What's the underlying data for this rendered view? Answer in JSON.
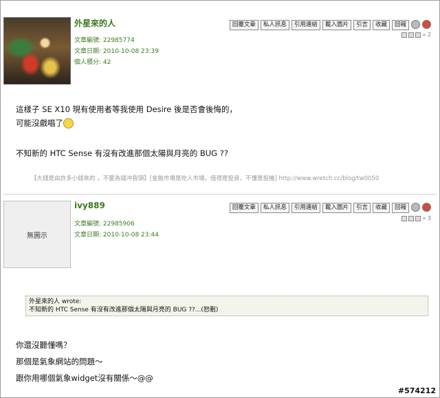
{
  "toolbar": {
    "buttons": [
      "回覆文章",
      "私人訊息",
      "引用連結",
      "載入圖片",
      "引言",
      "收藏",
      "回報"
    ]
  },
  "post1": {
    "username": "外星來的人",
    "article_id": "文章編號: 22985774",
    "article_date": "文章日期: 2010-10-08 23:39",
    "points": "個人積分: 42",
    "floor": "» 2",
    "lines": [
      "這樣子 SE X10 現有使用者等我使用 Desire 後是否會後悔的，",
      "可能沒戲唱了",
      "不知新的 HTC Sense 有沒有改進那個太陽與月亮的 BUG ??"
    ],
    "signature": "【大錢是由許多小錢來的 ，不要為錢冲昏頭】[金融市場是吃人市場，值得是投資，不懂是投機] http://www.wretch.cc/blog/tw0050"
  },
  "post2": {
    "username": "ivy889",
    "avatar_text": "無圖示",
    "article_id": "文章編號: 22985906",
    "article_date": "文章日期: 2010-10-08 23:44",
    "floor": "» 3",
    "quote_author": "外星來的人 wrote:",
    "quote_text": "不知新的 HTC Sense 有沒有改進那個太陽與月亮的 BUG ??...(恕刪)",
    "lines": [
      "你還沒聽懂嗎？",
      "那個是氣象網站的問題～",
      "跟你用哪個氣象widget沒有關係～@@"
    ]
  },
  "watermark": "#574212"
}
